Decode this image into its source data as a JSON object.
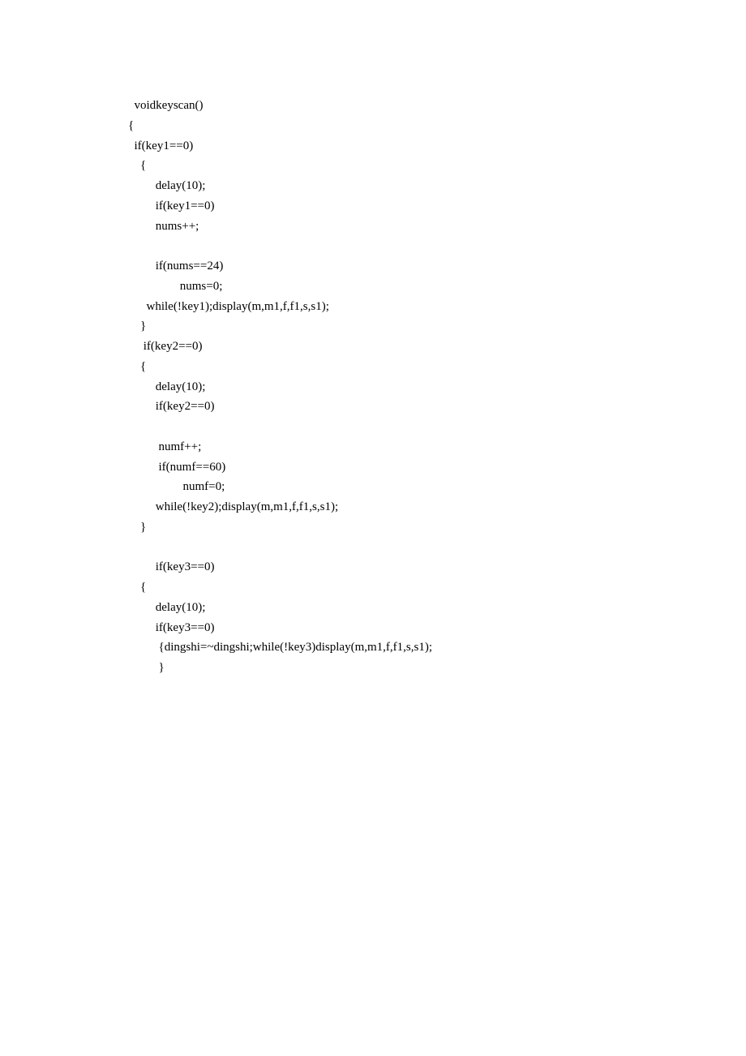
{
  "code": {
    "lines": [
      "  voidkeyscan()",
      "{",
      "  if(key1==0)",
      "    {",
      "         delay(10);",
      "         if(key1==0)",
      "         nums++;",
      "",
      "         if(nums==24)",
      "                 nums=0;",
      "      while(!key1);display(m,m1,f,f1,s,s1);",
      "    }",
      "     if(key2==0)",
      "    {",
      "         delay(10);",
      "         if(key2==0)",
      "",
      "          numf++;",
      "          if(numf==60)",
      "                  numf=0;",
      "         while(!key2);display(m,m1,f,f1,s,s1);",
      "    }",
      "",
      "         if(key3==0)",
      "    {",
      "         delay(10);",
      "         if(key3==0)",
      "          {dingshi=~dingshi;while(!key3)display(m,m1,f,f1,s,s1);",
      "          }"
    ]
  }
}
